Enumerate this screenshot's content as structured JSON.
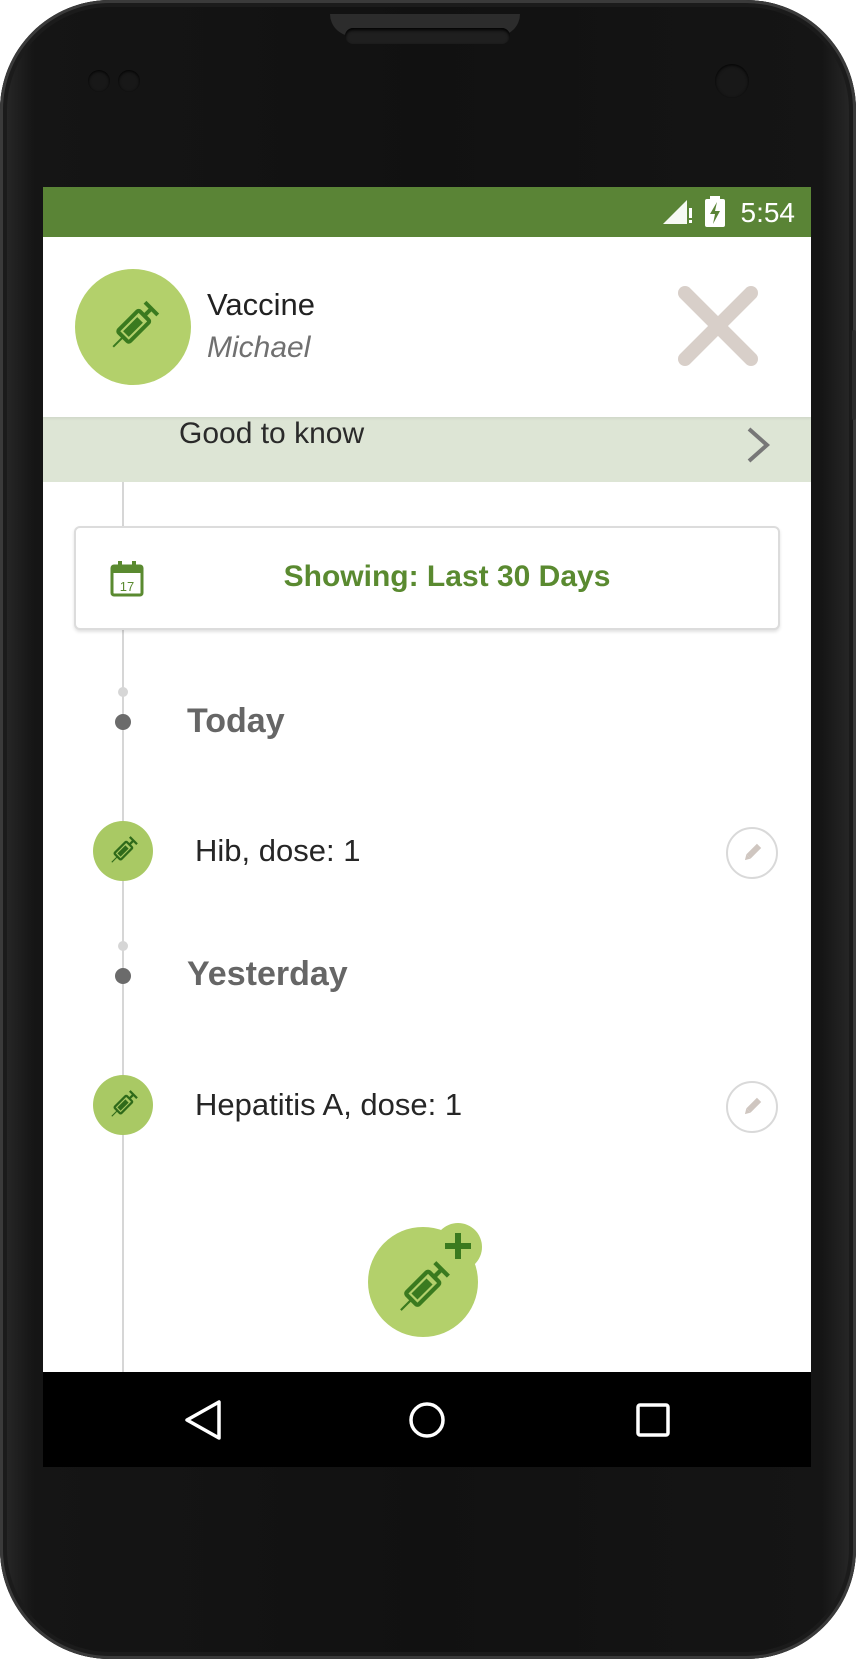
{
  "status_bar": {
    "time": "5:54"
  },
  "header": {
    "title": "Vaccine",
    "subtitle": "Michael",
    "avatar_icon": "syringe-icon",
    "close_icon": "close-icon"
  },
  "banner": {
    "label": "Good to know"
  },
  "filter": {
    "label": "Showing: Last 30 Days",
    "calendar_day": "17"
  },
  "timeline": {
    "groups": [
      {
        "day": "Today",
        "entries": [
          {
            "text": "Hib, dose: 1"
          }
        ]
      },
      {
        "day": "Yesterday",
        "entries": [
          {
            "text": "Hepatitis A, dose: 1"
          }
        ]
      }
    ]
  },
  "colors": {
    "status_bar": "#5a8436",
    "accent": "#b3d06b",
    "dark_green": "#3a7a1f",
    "banner_bg": "#dde5d5",
    "filter_text": "#5a8a30"
  }
}
